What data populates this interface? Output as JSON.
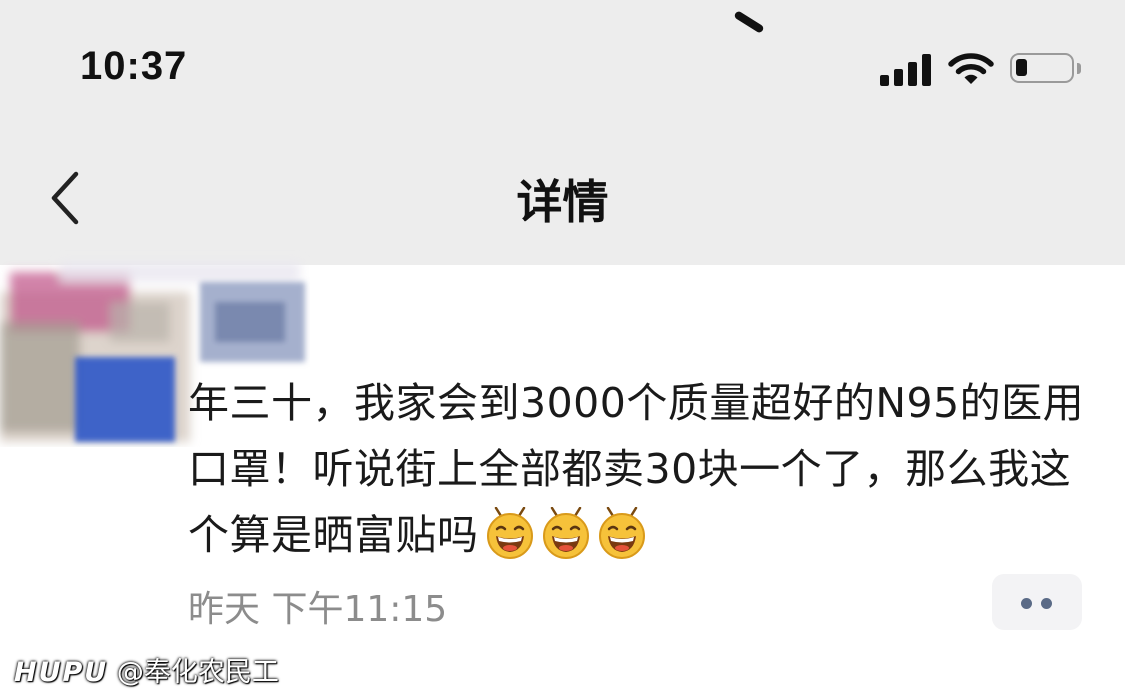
{
  "status_bar": {
    "time": "10:37",
    "battery_level": 0.2
  },
  "nav": {
    "back_icon": "chevron-left-icon",
    "title": "详情"
  },
  "post": {
    "avatar": "blurred-avatar",
    "text": "年三十，我家会到3000个质量超好的N95的医用口罩！听说街上全部都卖30块一个了，那么我这个算是晒富贴吗",
    "emojis": [
      "grinning-face-icon",
      "grinning-face-icon",
      "grinning-face-icon"
    ],
    "timestamp": "昨天 下午11:15",
    "more_icon": "more-dots-icon"
  },
  "watermark": {
    "brand": "HUPU",
    "user": "@奉化农民工"
  },
  "colors": {
    "header_bg": "#ededed",
    "page_bg": "#ffffff",
    "timestamp": "#8c8c8c",
    "more_button_bg": "#f3f3f5"
  }
}
